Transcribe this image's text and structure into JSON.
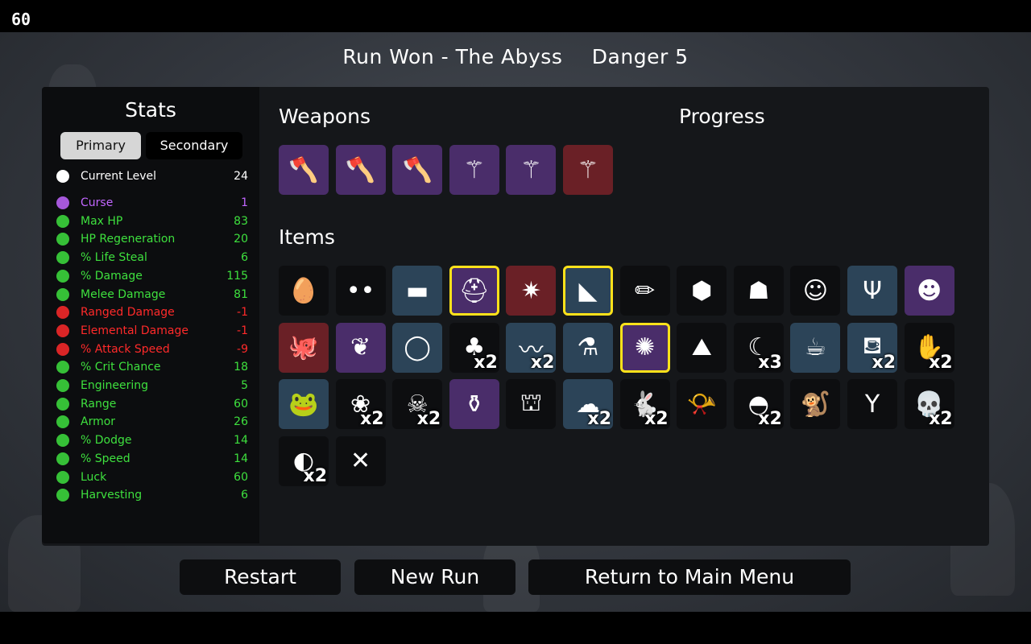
{
  "fps": "60",
  "header": {
    "run_result": "Run Won - The Abyss",
    "danger": "Danger 5"
  },
  "stats_panel": {
    "title": "Stats",
    "tabs": {
      "primary": "Primary",
      "secondary": "Secondary"
    },
    "current_level": {
      "label": "Current Level",
      "value": "24"
    },
    "rows": [
      {
        "label": "Curse",
        "value": "1",
        "color": "#c266ff",
        "icon": "curse-eye-icon"
      },
      {
        "label": "Max HP",
        "value": "83",
        "color": "#3ee03e",
        "icon": "heart-icon"
      },
      {
        "label": "HP Regeneration",
        "value": "20",
        "color": "#3ee03e",
        "icon": "regen-heart-icon"
      },
      {
        "label": "% Life Steal",
        "value": "6",
        "color": "#3ee03e",
        "icon": "fangs-icon"
      },
      {
        "label": "% Damage",
        "value": "115",
        "color": "#3ee03e",
        "icon": "muscle-icon"
      },
      {
        "label": "Melee Damage",
        "value": "81",
        "color": "#3ee03e",
        "icon": "sword-icon"
      },
      {
        "label": "Ranged Damage",
        "value": "-1",
        "color": "#ff2a2a",
        "icon": "bow-icon"
      },
      {
        "label": "Elemental Damage",
        "value": "-1",
        "color": "#ff2a2a",
        "icon": "flame-icon"
      },
      {
        "label": "% Attack Speed",
        "value": "-9",
        "color": "#ff2a2a",
        "icon": "hourglass-icon"
      },
      {
        "label": "% Crit Chance",
        "value": "18",
        "color": "#3ee03e",
        "icon": "crit-burst-icon"
      },
      {
        "label": "Engineering",
        "value": "5",
        "color": "#3ee03e",
        "icon": "wrench-icon"
      },
      {
        "label": "Range",
        "value": "60",
        "color": "#3ee03e",
        "icon": "range-icon"
      },
      {
        "label": "Armor",
        "value": "26",
        "color": "#3ee03e",
        "icon": "shield-icon"
      },
      {
        "label": "% Dodge",
        "value": "14",
        "color": "#3ee03e",
        "icon": "dodge-wind-icon"
      },
      {
        "label": "% Speed",
        "value": "14",
        "color": "#3ee03e",
        "icon": "boot-icon"
      },
      {
        "label": "Luck",
        "value": "60",
        "color": "#3ee03e",
        "icon": "dice-icon"
      },
      {
        "label": "Harvesting",
        "value": "6",
        "color": "#3ee03e",
        "icon": "wheat-icon"
      }
    ]
  },
  "weapons": {
    "title": "Weapons",
    "slots": [
      {
        "tier": "purple",
        "icon": "axe-icon"
      },
      {
        "tier": "purple",
        "icon": "axe-icon"
      },
      {
        "tier": "purple",
        "icon": "axe-icon"
      },
      {
        "tier": "purple",
        "icon": "spiked-club-icon"
      },
      {
        "tier": "purple",
        "icon": "spiked-club-icon"
      },
      {
        "tier": "red",
        "icon": "spiked-club-icon"
      }
    ]
  },
  "progress": {
    "title": "Progress"
  },
  "items": {
    "title": "Items",
    "slots": [
      {
        "tier": "black",
        "icon": "egg-mustache-icon",
        "glyph": "🥚",
        "count": "",
        "selected": false
      },
      {
        "tier": "black",
        "icon": "glowing-eyes-icon",
        "glyph": "••",
        "count": "",
        "selected": false
      },
      {
        "tier": "blue",
        "icon": "scarf-icon",
        "glyph": "▬",
        "count": "",
        "selected": false
      },
      {
        "tier": "purple",
        "icon": "knight-helmet-icon",
        "glyph": "⛑",
        "count": "",
        "selected": true
      },
      {
        "tier": "red",
        "icon": "spiky-creature-icon",
        "glyph": "✷",
        "count": "",
        "selected": false
      },
      {
        "tier": "blue",
        "icon": "gauntlet-blade-icon",
        "glyph": "◣",
        "count": "",
        "selected": true
      },
      {
        "tier": "black",
        "icon": "pencil-icon",
        "glyph": "✏",
        "count": "",
        "selected": false
      },
      {
        "tier": "black",
        "icon": "coal-rock-icon",
        "glyph": "⬢",
        "count": "",
        "selected": false
      },
      {
        "tier": "black",
        "icon": "ghost-statue-icon",
        "glyph": "☗",
        "count": "",
        "selected": false
      },
      {
        "tier": "black",
        "icon": "bandaged-face-icon",
        "glyph": "☺",
        "count": "",
        "selected": false
      },
      {
        "tier": "blue",
        "icon": "red-claws-icon",
        "glyph": "Ψ",
        "count": "",
        "selected": false
      },
      {
        "tier": "purple",
        "icon": "frog-creature-icon",
        "glyph": "☻",
        "count": "",
        "selected": false
      },
      {
        "tier": "red",
        "icon": "octopus-icon",
        "glyph": "🐙",
        "count": "",
        "selected": false
      },
      {
        "tier": "purple",
        "icon": "golden-bird-icon",
        "glyph": "❦",
        "count": "",
        "selected": false
      },
      {
        "tier": "blue",
        "icon": "amulet-icon",
        "glyph": "◯",
        "count": "",
        "selected": false
      },
      {
        "tier": "black",
        "icon": "tree-icon",
        "glyph": "♣",
        "count": "x2",
        "selected": false
      },
      {
        "tier": "blue",
        "icon": "worm-icon",
        "glyph": "〰",
        "count": "x2",
        "selected": false
      },
      {
        "tier": "blue",
        "icon": "potion-flask-icon",
        "glyph": "⚗",
        "count": "",
        "selected": false
      },
      {
        "tier": "purple",
        "icon": "flail-ball-icon",
        "glyph": "✺",
        "count": "",
        "selected": true
      },
      {
        "tier": "black",
        "icon": "dung-pile-icon",
        "glyph": "⛰",
        "count": "",
        "selected": false
      },
      {
        "tier": "black",
        "icon": "horn-icon",
        "glyph": "☾",
        "count": "x3",
        "selected": false
      },
      {
        "tier": "blue",
        "icon": "tea-cup-icon",
        "glyph": "☕",
        "count": "",
        "selected": false
      },
      {
        "tier": "blue",
        "icon": "bucket-icon",
        "glyph": "⛾",
        "count": "x2",
        "selected": false
      },
      {
        "tier": "black",
        "icon": "claw-hand-icon",
        "glyph": "✋",
        "count": "x2",
        "selected": false
      },
      {
        "tier": "blue",
        "icon": "frog-icon",
        "glyph": "🐸",
        "count": "",
        "selected": false
      },
      {
        "tier": "black",
        "icon": "butterfly-icon",
        "glyph": "❀",
        "count": "x2",
        "selected": false
      },
      {
        "tier": "black",
        "icon": "goat-skull-icon",
        "glyph": "☠",
        "count": "x2",
        "selected": false
      },
      {
        "tier": "purple",
        "icon": "mortar-pestle-icon",
        "glyph": "⚱",
        "count": "",
        "selected": false
      },
      {
        "tier": "black",
        "icon": "tooth-icon",
        "glyph": "⛫",
        "count": "",
        "selected": false
      },
      {
        "tier": "blue",
        "icon": "alert-cloud-icon",
        "glyph": "☁",
        "count": "x2",
        "selected": false
      },
      {
        "tier": "black",
        "icon": "rabbit-icon",
        "glyph": "🐇",
        "count": "x2",
        "selected": false
      },
      {
        "tier": "black",
        "icon": "whistle-icon",
        "glyph": "📯",
        "count": "",
        "selected": false
      },
      {
        "tier": "black",
        "icon": "propeller-cap-icon",
        "glyph": "◓",
        "count": "x2",
        "selected": false
      },
      {
        "tier": "black",
        "icon": "monkey-icon",
        "glyph": "🐒",
        "count": "",
        "selected": false
      },
      {
        "tier": "black",
        "icon": "sprout-icon",
        "glyph": "Y",
        "count": "",
        "selected": false
      },
      {
        "tier": "black",
        "icon": "skull-icon",
        "glyph": "💀",
        "count": "x2",
        "selected": false
      },
      {
        "tier": "black",
        "icon": "bloody-tooth-icon",
        "glyph": "◐",
        "count": "x2",
        "selected": false
      },
      {
        "tier": "black",
        "icon": "red-scratch-icon",
        "glyph": "✕",
        "count": "",
        "selected": false
      }
    ]
  },
  "buttons": {
    "restart": "Restart",
    "new_run": "New Run",
    "main_menu": "Return to Main Menu"
  }
}
